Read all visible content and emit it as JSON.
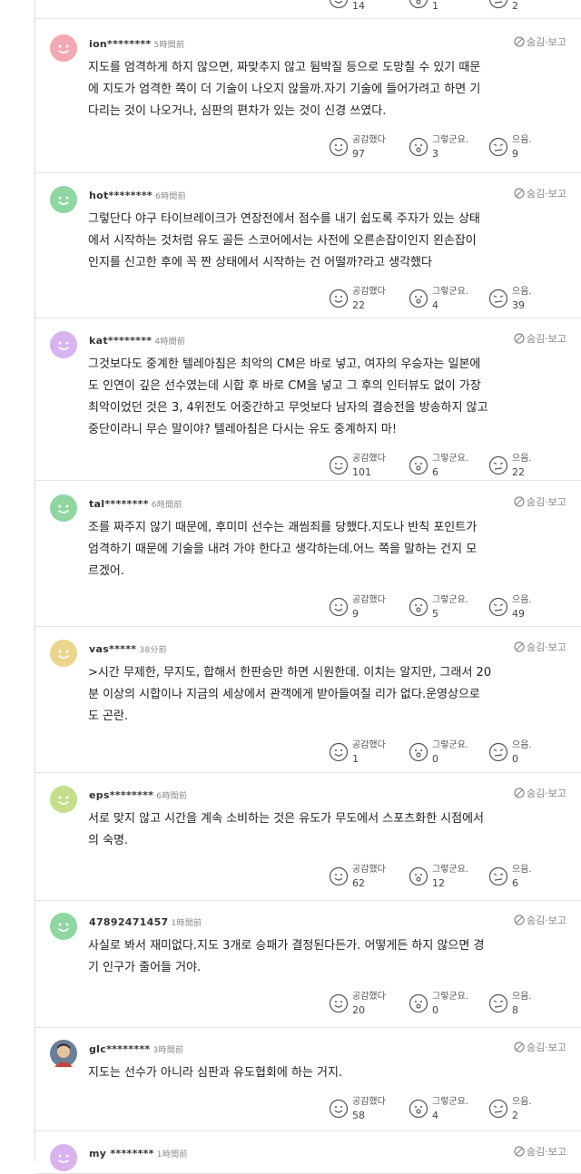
{
  "hide_label": "숨김·보고",
  "top_partial": {
    "likes": "14",
    "hmm": "1",
    "meh": "2"
  },
  "reaction_labels": {
    "like": "공감했다",
    "hmm": "그렇군요.",
    "meh": "으음."
  },
  "comments": [
    {
      "user": "ion********",
      "time": "5時間前",
      "avatar": "pink",
      "lines": [
        "지도를 엄격하게 하지 않으면, 짜맞추지 않고 뒴박질 등으로 도망칠 수 있기 때문",
        "에 지도가 엄격한 쪽이 더 기술이 나오지 않을까.자기 기술에 들어가려고 하면 기",
        "다리는 것이 나오거나, 심판의 편차가 있는 것이 신경 쓰였다."
      ],
      "likes": "97",
      "hmm": "3",
      "meh": "9"
    },
    {
      "user": "hot********",
      "time": "6時間前",
      "avatar": "green",
      "lines": [
        "그렇단다 야구 타이브레이크가 연장전에서 점수를 내기 쉽도록 주자가 있는 상태",
        "에서 시작하는 것처럼 유도 골든 스코어에서는 사전에 오른손잡이인지 왼손잡이",
        "인지를 신고한 후에 꼭 짠 상태에서 시작하는 건 어떨까?라고 생각했다"
      ],
      "likes": "22",
      "hmm": "4",
      "meh": "39"
    },
    {
      "user": "kat********",
      "time": "4時間前",
      "avatar": "purple",
      "lines": [
        "그것보다도 중계한 텔레아침은 최악의 CM은 바로 넣고, 여자의 우승자는 일본에",
        "도 인연이 깊은 선수였는데 시합 후 바로 CM을 넣고 그 후의 인터뷰도 없이 가장",
        "최악이었던 것은 3, 4위전도 어중간하고 무엇보다 남자의 결승전을 방송하지 않고",
        "중단이라니 무슨 말이야? 텔레아침은 다시는 유도 중계하지 마!"
      ],
      "likes": "101",
      "hmm": "6",
      "meh": "22"
    },
    {
      "user": "tal********",
      "time": "6時間前",
      "avatar": "green",
      "lines": [
        "조를 짜주지 않기 때문에, 후미미 선수는 괘씸죄를 당했다.지도나 반칙 포인트가",
        "엄격하기 때문에 기술을 내려 가야 한다고 생각하는데.어느 쪽을 말하는 건지 모",
        "르겠어."
      ],
      "likes": "9",
      "hmm": "5",
      "meh": "49"
    },
    {
      "user": "vas*****",
      "time": "38分前",
      "avatar": "yellow",
      "lines": [
        ">시간 무제한, 무지도, 합해서 한판승만 하면 시원한데. 이치는 알지만, 그래서 20",
        "분 이상의 시합이나 지금의 세상에서 관객에게 받아들여질 리가 없다.운영상으로",
        "도 곤란."
      ],
      "likes": "1",
      "hmm": "0",
      "meh": "0"
    },
    {
      "user": "eps********",
      "time": "6時間前",
      "avatar": "lime",
      "lines": [
        "서로 맞지 않고 시간을 계속 소비하는 것은 유도가 무도에서 스포츠화한 시점에서",
        "의 숙명."
      ],
      "likes": "62",
      "hmm": "12",
      "meh": "6"
    },
    {
      "user": "47892471457",
      "time": "1時間前",
      "avatar": "green",
      "lines": [
        "사실로 봐서 재미없다.지도 3개로 승패가 결정된다든가. 어떻게든 하지 않으면 경",
        "기 인구가 줄어들 거야."
      ],
      "likes": "20",
      "hmm": "0",
      "meh": "8"
    },
    {
      "user": "glc********",
      "time": "3時間前",
      "avatar": "photo",
      "lines": [
        "지도는 선수가 아니라 심판과 유도협회에 하는 거지."
      ],
      "likes": "58",
      "hmm": "4",
      "meh": "2"
    },
    {
      "user": "my ********",
      "time": "1時間前",
      "avatar": "purple",
      "lines": [],
      "likes": "",
      "hmm": "",
      "meh": ""
    }
  ]
}
